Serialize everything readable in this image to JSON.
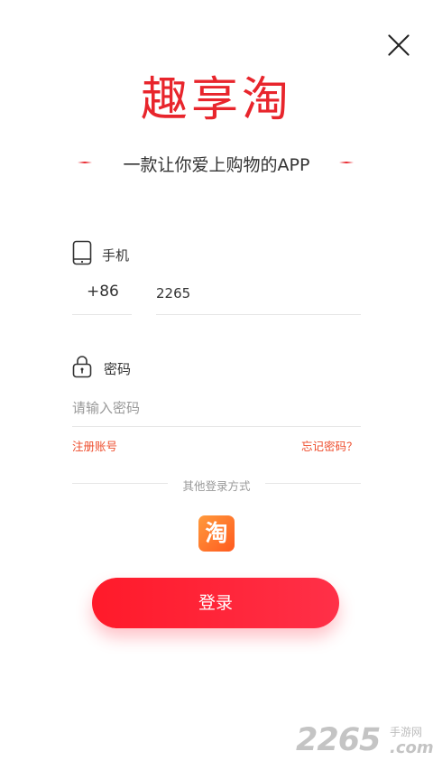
{
  "header": {
    "close_icon": "close-icon"
  },
  "brand": {
    "logo_text": "趣享淘",
    "tagline": "一款让你爱上购物的APP",
    "accent_color": "#e8252c"
  },
  "phone": {
    "label": "手机",
    "icon": "phone-icon",
    "country_code": "+86",
    "value": "2265"
  },
  "password": {
    "label": "密码",
    "icon": "lock-icon",
    "placeholder": "请输入密码"
  },
  "links": {
    "register": "注册账号",
    "forgot": "忘记密码？"
  },
  "other_login": {
    "label": "其他登录方式",
    "taobao_glyph": "淘"
  },
  "login_button": {
    "label": "登录",
    "color": "#ff1a2a"
  },
  "watermark": {
    "number": "2265",
    "cn": "手游网",
    "suffix": ".com"
  }
}
